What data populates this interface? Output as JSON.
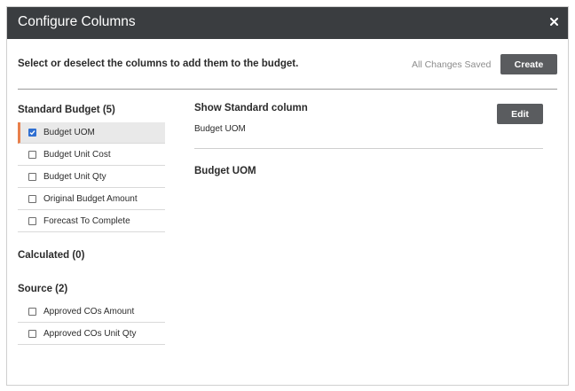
{
  "modal": {
    "title": "Configure Columns",
    "close_icon": "close-icon",
    "instruction": "Select or deselect the columns to add them to the budget.",
    "save_status": "All Changes Saved",
    "create_label": "Create"
  },
  "sections": {
    "standard": {
      "title": "Standard Budget (5)",
      "items": [
        {
          "label": "Budget UOM",
          "checked": true
        },
        {
          "label": "Budget Unit Cost",
          "checked": false
        },
        {
          "label": "Budget Unit Qty",
          "checked": false
        },
        {
          "label": "Original Budget Amount",
          "checked": false
        },
        {
          "label": "Forecast To Complete",
          "checked": false
        }
      ]
    },
    "calculated": {
      "title": "Calculated (0)"
    },
    "source": {
      "title": "Source (2)",
      "items": [
        {
          "label": "Approved COs Amount",
          "checked": false
        },
        {
          "label": "Approved COs Unit Qty",
          "checked": false
        }
      ]
    }
  },
  "detail": {
    "show_title": "Show Standard column",
    "show_value": "Budget UOM",
    "edit_label": "Edit",
    "heading": "Budget UOM"
  },
  "colors": {
    "header_bg": "#3a3d40",
    "button_bg": "#5a5c5f",
    "selected_accent": "#e8804c",
    "checkbox_checked": "#2f6fd1"
  }
}
